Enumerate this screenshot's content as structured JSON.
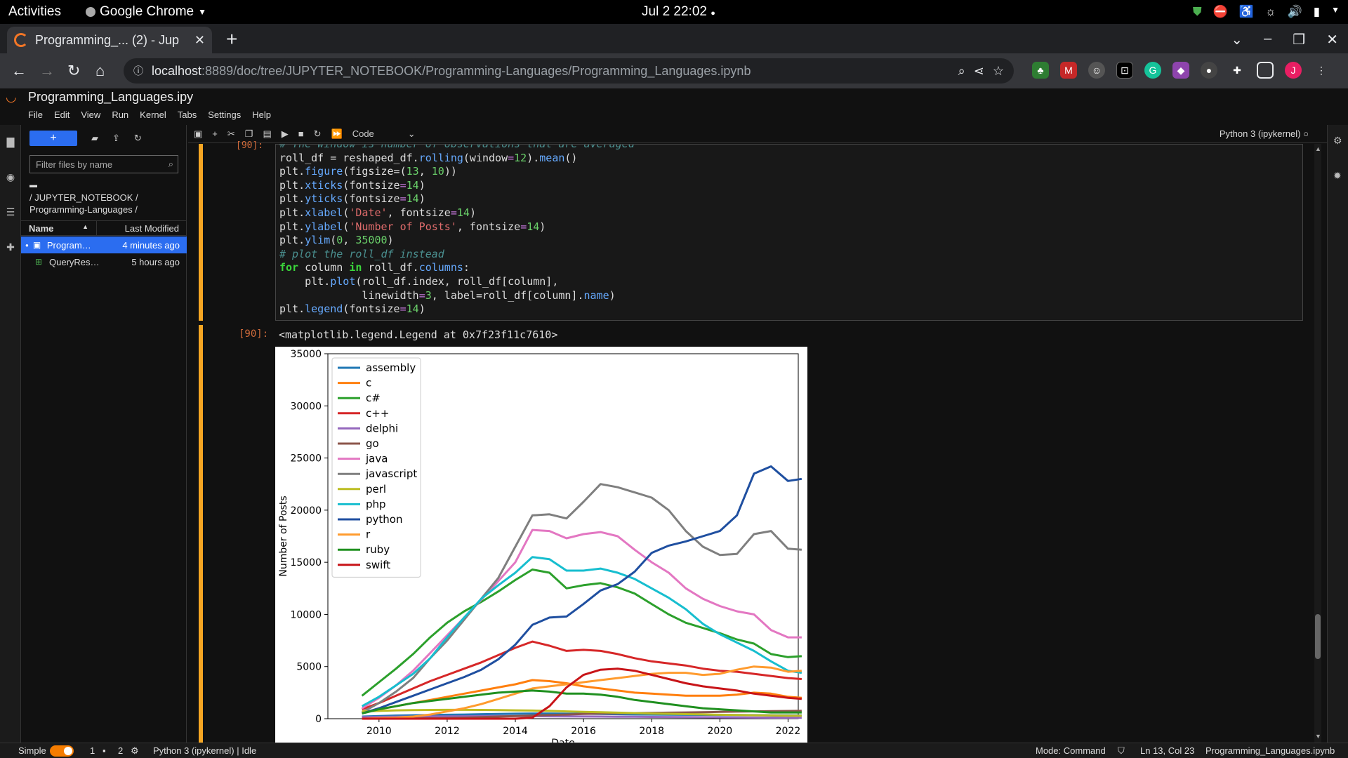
{
  "topbar": {
    "activities": "Activities",
    "app": "Google Chrome",
    "clock": "Jul 2  22:02"
  },
  "browser": {
    "tab_title": "Programming_... (2) - Jup",
    "url_host": "localhost",
    "url_path": ":8889/doc/tree/JUPYTER_NOTEBOOK/Programming-Languages/Programming_Languages.ipynb",
    "profile_initial": "J"
  },
  "jupyter": {
    "notebook_title": "Programming_Languages.ipy",
    "menu": [
      "File",
      "Edit",
      "View",
      "Run",
      "Kernel",
      "Tabs",
      "Settings",
      "Help"
    ],
    "cell_type": "Code",
    "kernel": "Python 3 (ipykernel)"
  },
  "filebrowser": {
    "new_label": "+",
    "filter_placeholder": "Filter files by name",
    "breadcrumb": "/ JUPYTER_NOTEBOOK / Programming-Languages /",
    "col_name": "Name",
    "col_modified": "Last Modified",
    "files": [
      {
        "name": "Programming_Languages.ipynb",
        "short": "Program…",
        "modified": "4 minutes ago",
        "selected": true
      },
      {
        "name": "QueryResults.csv",
        "short": "QueryRes…",
        "modified": "5 hours ago",
        "selected": false
      }
    ]
  },
  "cell": {
    "in_prompt": "[90]:",
    "out_prompt": "[90]:",
    "output_text": "<matplotlib.legend.Legend at 0x7f23f11c7610>",
    "code_lines": [
      "# The window is number of observations that are averaged",
      "roll_df = reshaped_df.rolling(window=12).mean()",
      "plt.figure(figsize=(13,10))",
      "plt.xticks(fontsize=14)",
      "plt.yticks(fontsize=14)",
      "plt.xlabel('Date', fontsize=14)",
      "plt.ylabel('Number of Posts', fontsize=14)",
      "plt.ylim(0, 35000)",
      "# plot the roll_df instead",
      "for column in roll_df.columns:",
      "    plt.plot(roll_df.index, roll_df[column],",
      "             linewidth=3, label=roll_df[column].name)",
      "plt.legend(fontsize=14)"
    ]
  },
  "status": {
    "mode_label": "Simple",
    "count1": "1",
    "count2": "2",
    "kernel_status": "Python 3 (ipykernel) | Idle",
    "mode": "Mode: Command",
    "cursor": "Ln 13, Col 23",
    "filename": "Programming_Languages.ipynb"
  },
  "chart_data": {
    "type": "line",
    "xlabel": "Date",
    "ylabel": "Number of Posts",
    "ylim": [
      0,
      35000
    ],
    "xlim": [
      2008.5,
      2022.3
    ],
    "yticks": [
      0,
      5000,
      10000,
      15000,
      20000,
      25000,
      30000,
      35000
    ],
    "xticks": [
      2010,
      2012,
      2014,
      2016,
      2018,
      2020,
      2022
    ],
    "legend_position": "top-left",
    "x": [
      2009.5,
      2010,
      2010.5,
      2011,
      2011.5,
      2012,
      2012.5,
      2013,
      2013.5,
      2014,
      2014.5,
      2015,
      2015.5,
      2016,
      2016.5,
      2017,
      2017.5,
      2018,
      2018.5,
      2019,
      2019.5,
      2020,
      2020.5,
      2021,
      2021.5,
      2022,
      2022.4
    ],
    "series": [
      {
        "name": "assembly",
        "color": "#1f77b4",
        "values": [
          200,
          250,
          300,
          330,
          350,
          380,
          400,
          430,
          450,
          480,
          500,
          500,
          480,
          470,
          450,
          430,
          410,
          400,
          390,
          380,
          370,
          360,
          350,
          340,
          330,
          320,
          310
        ]
      },
      {
        "name": "c",
        "color": "#ff7f0e",
        "values": [
          600,
          900,
          1200,
          1500,
          1800,
          2100,
          2400,
          2700,
          3000,
          3300,
          3700,
          3600,
          3400,
          3100,
          2900,
          2700,
          2500,
          2400,
          2300,
          2200,
          2200,
          2200,
          2300,
          2500,
          2400,
          2100,
          2000
        ]
      },
      {
        "name": "c#",
        "color": "#2ca02c",
        "values": [
          2200,
          3500,
          4800,
          6200,
          7800,
          9200,
          10300,
          11200,
          12200,
          13300,
          14300,
          14000,
          12500,
          12800,
          13000,
          12600,
          12000,
          11000,
          10000,
          9200,
          8700,
          8200,
          7600,
          7200,
          6200,
          5900,
          6000
        ]
      },
      {
        "name": "c++",
        "color": "#d62728",
        "values": [
          900,
          1500,
          2200,
          2900,
          3600,
          4200,
          4800,
          5400,
          6100,
          6800,
          7400,
          7000,
          6500,
          6600,
          6500,
          6200,
          5800,
          5500,
          5300,
          5100,
          4800,
          4600,
          4500,
          4300,
          4100,
          3900,
          3800
        ]
      },
      {
        "name": "delphi",
        "color": "#9467bd",
        "values": [
          150,
          170,
          190,
          200,
          210,
          220,
          230,
          240,
          250,
          250,
          240,
          230,
          220,
          210,
          200,
          190,
          180,
          170,
          160,
          150,
          140,
          130,
          120,
          110,
          100,
          95,
          90
        ]
      },
      {
        "name": "go",
        "color": "#8c564b",
        "values": [
          0,
          0,
          10,
          20,
          40,
          70,
          100,
          150,
          200,
          250,
          300,
          350,
          400,
          450,
          500,
          520,
          540,
          560,
          580,
          600,
          620,
          650,
          680,
          700,
          720,
          740,
          760
        ]
      },
      {
        "name": "java",
        "color": "#e377c2",
        "values": [
          1000,
          2000,
          3200,
          4600,
          6300,
          8000,
          9700,
          11400,
          13200,
          15000,
          18100,
          18000,
          17300,
          17700,
          17900,
          17500,
          16200,
          15000,
          14000,
          12500,
          11500,
          10800,
          10300,
          10000,
          8500,
          7800,
          7800
        ]
      },
      {
        "name": "javascript",
        "color": "#7f7f7f",
        "values": [
          600,
          1500,
          2600,
          3900,
          5800,
          7500,
          9500,
          11500,
          13500,
          16500,
          19500,
          19600,
          19200,
          20800,
          22500,
          22200,
          21700,
          21200,
          20000,
          18000,
          16500,
          15700,
          15800,
          17700,
          18000,
          16300,
          16200
        ]
      },
      {
        "name": "perl",
        "color": "#bcbd22",
        "values": [
          700,
          750,
          800,
          820,
          840,
          850,
          850,
          840,
          820,
          800,
          780,
          750,
          700,
          660,
          620,
          580,
          540,
          500,
          470,
          440,
          410,
          380,
          350,
          330,
          310,
          290,
          280
        ]
      },
      {
        "name": "php",
        "color": "#17becf",
        "values": [
          1200,
          2100,
          3200,
          4300,
          5800,
          7800,
          9700,
          11500,
          12800,
          14000,
          15500,
          15300,
          14200,
          14200,
          14400,
          14000,
          13400,
          12500,
          11600,
          10500,
          9100,
          8100,
          7300,
          6500,
          5500,
          4600,
          4400
        ]
      },
      {
        "name": "python",
        "color": "#1f4fa0",
        "values": [
          500,
          1000,
          1600,
          2200,
          2800,
          3400,
          4000,
          4700,
          5700,
          7100,
          9000,
          9700,
          9800,
          11000,
          12300,
          12900,
          14100,
          15900,
          16600,
          17000,
          17500,
          18000,
          19500,
          23500,
          24200,
          22800,
          23000
        ]
      },
      {
        "name": "r",
        "color": "#ff9b2e",
        "values": [
          0,
          50,
          100,
          200,
          400,
          700,
          1000,
          1400,
          1900,
          2400,
          2900,
          3100,
          3300,
          3500,
          3700,
          3900,
          4100,
          4300,
          4400,
          4400,
          4200,
          4300,
          4700,
          5000,
          4900,
          4500,
          4600
        ]
      },
      {
        "name": "ruby",
        "color": "#209020",
        "values": [
          500,
          900,
          1200,
          1500,
          1700,
          1900,
          2100,
          2300,
          2500,
          2600,
          2700,
          2600,
          2400,
          2400,
          2300,
          2100,
          1800,
          1600,
          1400,
          1200,
          1000,
          900,
          800,
          700,
          600,
          600,
          600
        ]
      },
      {
        "name": "swift",
        "color": "#c81418",
        "values": [
          0,
          0,
          0,
          0,
          0,
          0,
          0,
          0,
          0,
          0,
          100,
          1200,
          3000,
          4200,
          4700,
          4800,
          4600,
          4200,
          3800,
          3400,
          3100,
          2900,
          2700,
          2400,
          2200,
          2000,
          1900
        ]
      }
    ]
  }
}
